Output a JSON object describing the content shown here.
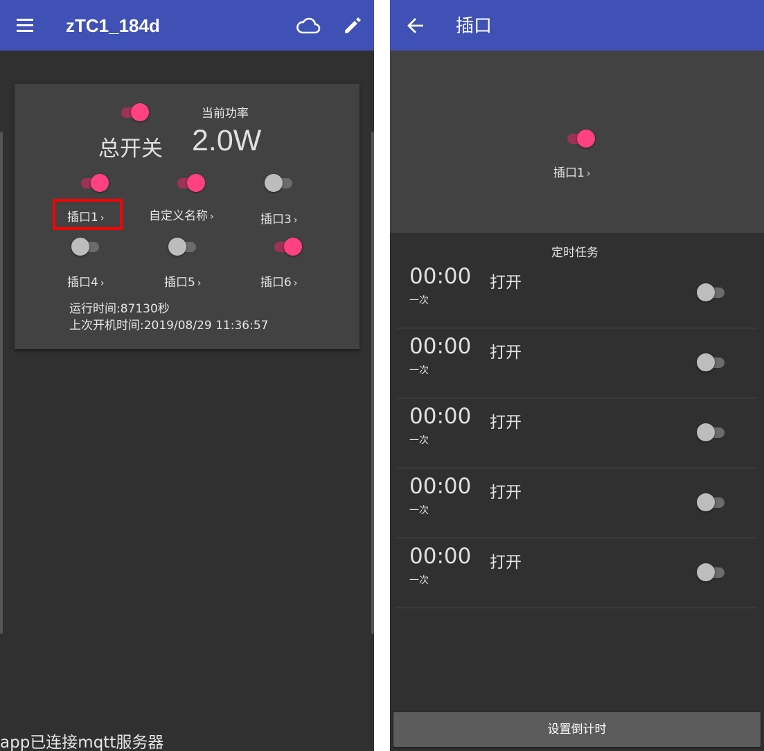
{
  "left": {
    "appbar": {
      "title": "zTC1_184d",
      "icons": [
        "menu-icon",
        "cloud-icon",
        "edit-icon"
      ]
    },
    "card": {
      "power_label": "当前功率",
      "master_label": "总开关",
      "power_value": "2.0W",
      "master_on": true,
      "slots": [
        {
          "label": "插口1",
          "on": true,
          "highlighted": true
        },
        {
          "label": "自定义名称",
          "on": true,
          "highlighted": false
        },
        {
          "label": "插口3",
          "on": false,
          "highlighted": false
        },
        {
          "label": "插口4",
          "on": false,
          "highlighted": false
        },
        {
          "label": "插口5",
          "on": false,
          "highlighted": false
        },
        {
          "label": "插口6",
          "on": true,
          "highlighted": false
        }
      ],
      "uptime": "运行时间:87130秒",
      "last_boot": "上次开机时间:2019/08/29 11:36:57"
    },
    "status": "app已连接mqtt服务器"
  },
  "right": {
    "appbar": {
      "title": "插口",
      "icons": [
        "back-arrow-icon"
      ]
    },
    "hero": {
      "slot_label": "插口1",
      "on": true
    },
    "section_title": "定时任务",
    "tasks": [
      {
        "time": "00:00",
        "repeat": "一次",
        "action": "打开",
        "enabled": false
      },
      {
        "time": "00:00",
        "repeat": "一次",
        "action": "打开",
        "enabled": false
      },
      {
        "time": "00:00",
        "repeat": "一次",
        "action": "打开",
        "enabled": false
      },
      {
        "time": "00:00",
        "repeat": "一次",
        "action": "打开",
        "enabled": false
      },
      {
        "time": "00:00",
        "repeat": "一次",
        "action": "打开",
        "enabled": false
      }
    ],
    "countdown_button": "设置倒计时"
  },
  "colors": {
    "primary": "#3F51B5",
    "accent": "#FF4081",
    "background": "#303030",
    "card": "#424242",
    "highlight": "#FF0000"
  }
}
